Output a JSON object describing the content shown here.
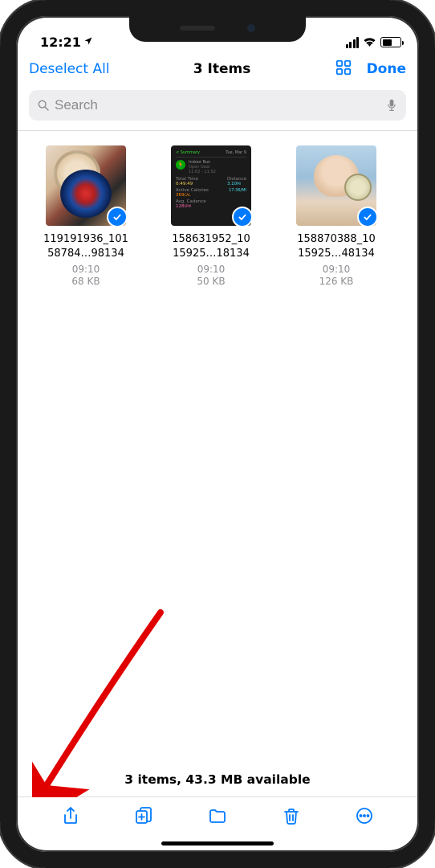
{
  "status": {
    "time": "12:21",
    "battery_pct": 45
  },
  "nav": {
    "deselect": "Deselect All",
    "title": "3 Items",
    "done": "Done"
  },
  "search": {
    "placeholder": "Search"
  },
  "files": [
    {
      "name_line1": "119191936_101",
      "name_line2": "58784…98134",
      "time": "09:10",
      "size": "68 KB",
      "selected": true,
      "thumb": "photo-medal-selfie"
    },
    {
      "name_line1": "158631952_10",
      "name_line2": "15925…18134",
      "time": "09:10",
      "size": "50 KB",
      "selected": true,
      "thumb": "workout-summary-dark",
      "workout": {
        "summary_label": "Summary",
        "date": "Tue, Mar 9",
        "type": "Indoor Run",
        "time_range": "11:02 - 11:52",
        "total_time_label": "Total Time",
        "total_time": "0:49:49",
        "distance_label": "Distance",
        "distance": "3.10",
        "distance_unit": "MI",
        "calories_label": "Active Calories",
        "calories": "369",
        "calories_unit": "CAL",
        "cadence_label": "Avg. Cadence",
        "cadence": "128",
        "cadence_unit": "SPM",
        "pace": "17:36/MI"
      }
    },
    {
      "name_line1": "158870388_10",
      "name_line2": "15925…48134",
      "time": "09:10",
      "size": "126 KB",
      "selected": true,
      "thumb": "photo-medal-outdoor"
    }
  ],
  "summary": "3 items, 43.3 MB available",
  "toolbar": {
    "share": "share-icon",
    "duplicate": "duplicate-icon",
    "move": "folder-icon",
    "delete": "trash-icon",
    "more": "more-icon"
  },
  "annotation": {
    "points_to": "share-button"
  }
}
